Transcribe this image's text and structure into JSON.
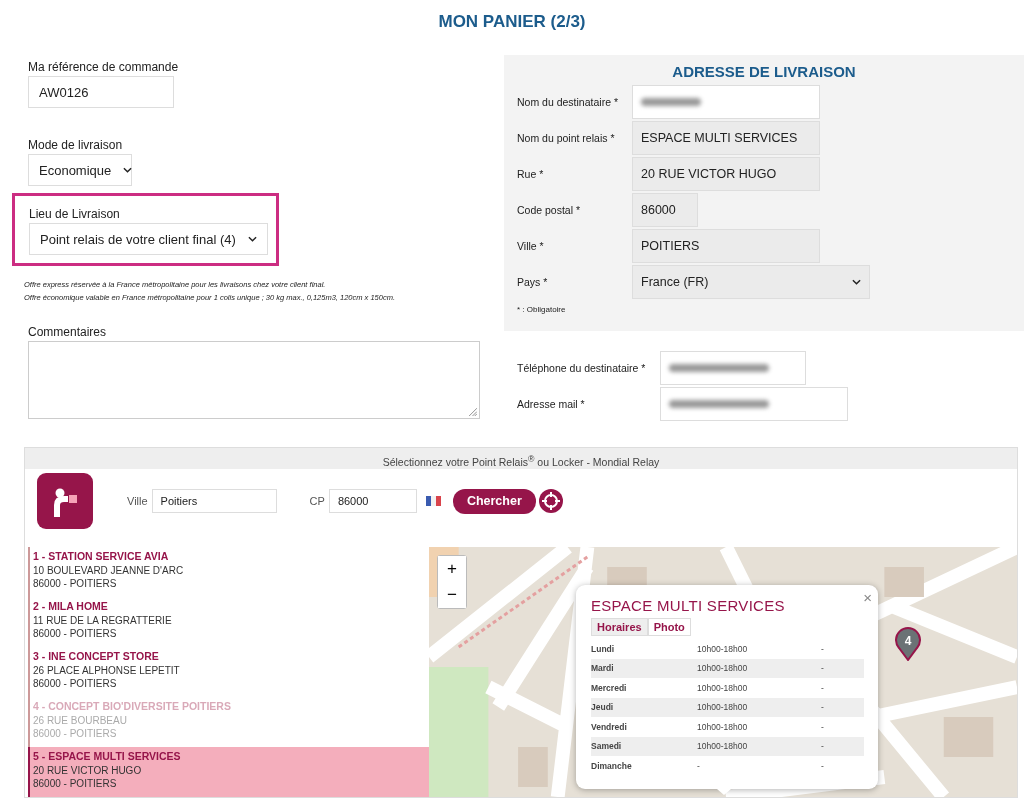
{
  "title": "MON PANIER (2/3)",
  "order": {
    "reference": {
      "label": "Ma référence de commande",
      "value": "AW0126"
    },
    "delivery_mode": {
      "label": "Mode de livraison",
      "value": "Economique"
    },
    "delivery_place": {
      "label": "Lieu de Livraison",
      "value": "Point relais de votre client final (4)",
      "highlighted": true
    },
    "notes": [
      "Offre express réservée à la France métropolitaine pour les livraisons chez votre client final.",
      "Offre économique valable en France métropolitaine pour 1 colis unique ; 30 kg max., 0,125m3, 120cm x 150cm."
    ],
    "comments": {
      "label": "Commentaires"
    }
  },
  "address": {
    "heading": "ADRESSE DE LIVRAISON",
    "fields": [
      {
        "label": "Nom du destinataire *",
        "kind": "redacted",
        "readonly": false
      },
      {
        "label": "Nom du point relais *",
        "value": "ESPACE MULTI SERVICES",
        "kind": "text",
        "readonly": true
      },
      {
        "label": "Rue *",
        "value": "20 RUE VICTOR HUGO",
        "kind": "text",
        "readonly": true
      },
      {
        "label": "Code postal *",
        "value": "86000",
        "kind": "short",
        "readonly": true
      },
      {
        "label": "Ville *",
        "value": "POITIERS",
        "kind": "text",
        "readonly": true
      },
      {
        "label": "Pays *",
        "value": "France (FR)",
        "kind": "select",
        "readonly": true
      }
    ],
    "required_note": "* : Obligatoire"
  },
  "contact": [
    {
      "label": "Téléphone du destinataire *",
      "kind": "redacted"
    },
    {
      "label": "Adresse mail *",
      "kind": "redacted"
    }
  ],
  "relay": {
    "header": "Sélectionnez votre Point Relais$^{®}$ ou Locker - Mondial Relay",
    "search": {
      "city_label": "Ville",
      "city": "Poitiers",
      "cp_label": "CP",
      "cp": "86000",
      "button": "Chercher"
    },
    "points": [
      {
        "name": "1 - STATION SERVICE AVIA",
        "street": "10 BOULEVARD JEANNE D'ARC",
        "city": "86000 - POITIERS",
        "selected": false,
        "disabled": false
      },
      {
        "name": "2 - MILA HOME",
        "street": "11 RUE DE LA REGRATTERIE",
        "city": "86000 - POITIERS",
        "selected": false,
        "disabled": false
      },
      {
        "name": "3 - INE CONCEPT STORE",
        "street": "26 PLACE ALPHONSE LEPETIT",
        "city": "86000 - POITIERS",
        "selected": false,
        "disabled": false
      },
      {
        "name": "4 - CONCEPT BIO'DIVERSITE POITIERS",
        "street": "26 RUE BOURBEAU",
        "city": "86000 - POITIERS",
        "selected": false,
        "disabled": true
      },
      {
        "name": "5 - ESPACE MULTI SERVICES",
        "street": "20 RUE VICTOR HUGO",
        "city": "86000 - POITIERS",
        "selected": true,
        "disabled": false
      }
    ],
    "map": {
      "zoom_in": "+",
      "zoom_out": "−",
      "marker": "4",
      "popup": {
        "title": "ESPACE MULTI SERVICES",
        "close": "×",
        "tabs": [
          {
            "label": "Horaires",
            "selected": true
          },
          {
            "label": "Photo",
            "selected": false
          }
        ],
        "hours": [
          {
            "day": "Lundi",
            "morning": "10h00-18h00",
            "afternoon": "-"
          },
          {
            "day": "Mardi",
            "morning": "10h00-18h00",
            "afternoon": "-"
          },
          {
            "day": "Mercredi",
            "morning": "10h00-18h00",
            "afternoon": "-"
          },
          {
            "day": "Jeudi",
            "morning": "10h00-18h00",
            "afternoon": "-"
          },
          {
            "day": "Vendredi",
            "morning": "10h00-18h00",
            "afternoon": "-"
          },
          {
            "day": "Samedi",
            "morning": "10h00-18h00",
            "afternoon": "-"
          },
          {
            "day": "Dimanche",
            "morning": "-",
            "afternoon": "-"
          }
        ]
      }
    }
  }
}
